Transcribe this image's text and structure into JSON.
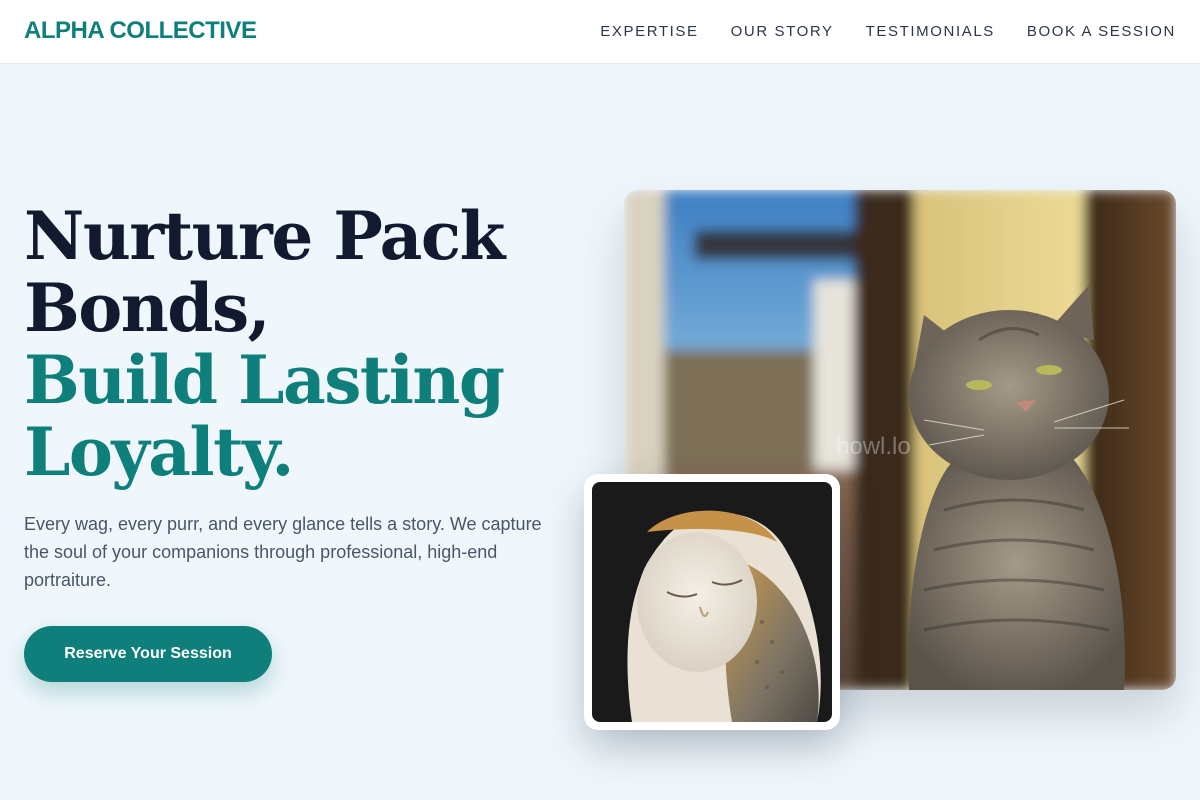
{
  "nav": {
    "brand": "ALPHA COLLECTIVE",
    "links": [
      "EXPERTISE",
      "OUR STORY",
      "TESTIMONIALS",
      "BOOK A SESSION"
    ]
  },
  "hero": {
    "headline_lines": [
      "Nurture Pack",
      "Bonds,"
    ],
    "accent_lines": [
      "Build Lasting",
      "Loyalty."
    ],
    "lede": "Every wag, every purr, and every glance tells a story. We capture the soul of your companions through professional, high-end portraiture.",
    "cta_label": "Reserve Your Session"
  },
  "images": {
    "main_watermark": "howl.lo"
  },
  "colors": {
    "accent": "#0e7f7a",
    "headline": "#111a2e",
    "background": "#f0f7fc",
    "body_text": "#4a5568"
  }
}
